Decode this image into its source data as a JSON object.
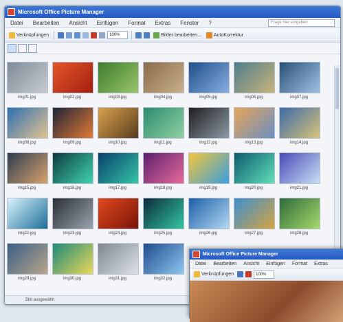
{
  "window": {
    "title": "Microsoft Office Picture Manager",
    "menu": [
      "Datei",
      "Bearbeiten",
      "Ansicht",
      "Einfügen",
      "Format",
      "Extras",
      "Fenster",
      "?"
    ],
    "help_placeholder": "Frage hier eingeben",
    "toolbar": {
      "shortcuts_label": "Verknüpfungen",
      "zoom": "100%",
      "edit_label": "Bilder bearbeiten...",
      "autocorrect_label": "AutoKorrektur"
    },
    "status_text": "Bild ausgewählt"
  },
  "thumbnails": [
    {
      "caption": "img01.jpg",
      "colors": [
        "#7f8a96",
        "#c7ccd2"
      ]
    },
    {
      "caption": "img02.jpg",
      "colors": [
        "#e3562b",
        "#a61f0f"
      ]
    },
    {
      "caption": "img03.jpg",
      "colors": [
        "#3d7d2e",
        "#9ac56a"
      ]
    },
    {
      "caption": "img04.jpg",
      "colors": [
        "#8a6a4a",
        "#c9b08a"
      ]
    },
    {
      "caption": "img05.jpg",
      "colors": [
        "#1e4f8a",
        "#87aee0"
      ]
    },
    {
      "caption": "img06.jpg",
      "colors": [
        "#4f7d8c",
        "#c7b57a"
      ]
    },
    {
      "caption": "img07.jpg",
      "colors": [
        "#2c4f78",
        "#9ec1e3"
      ]
    },
    {
      "caption": "img08.jpg",
      "colors": [
        "#2f6fb3",
        "#e2c48f"
      ]
    },
    {
      "caption": "img09.jpg",
      "colors": [
        "#1e2438",
        "#e37a35"
      ]
    },
    {
      "caption": "img10.jpg",
      "colors": [
        "#d9a24b",
        "#5a3b1e"
      ]
    },
    {
      "caption": "img11.jpg",
      "colors": [
        "#2c8c6e",
        "#8fd1a2"
      ]
    },
    {
      "caption": "img12.jpg",
      "colors": [
        "#1f1f1f",
        "#8e9aa6"
      ]
    },
    {
      "caption": "img13.jpg",
      "colors": [
        "#e6a55b",
        "#6a8fc0"
      ]
    },
    {
      "caption": "img14.jpg",
      "colors": [
        "#3c6aa8",
        "#d9c37a"
      ]
    },
    {
      "caption": "img15.jpg",
      "colors": [
        "#2e3d52",
        "#d8a26b"
      ]
    },
    {
      "caption": "img16.jpg",
      "colors": [
        "#0e3a3d",
        "#3fd5b0"
      ]
    },
    {
      "caption": "img17.jpg",
      "colors": [
        "#0a3f6b",
        "#33c6a6"
      ]
    },
    {
      "caption": "img18.jpg",
      "colors": [
        "#5b1f6e",
        "#e86a9a"
      ]
    },
    {
      "caption": "img19.jpg",
      "colors": [
        "#f2c43a",
        "#3aa0e0"
      ]
    },
    {
      "caption": "img20.jpg",
      "colors": [
        "#0e5a6e",
        "#5fe0b8"
      ]
    },
    {
      "caption": "img21.jpg",
      "colors": [
        "#4a4ab8",
        "#c7e0f5"
      ]
    },
    {
      "caption": "img22.jpg",
      "colors": [
        "#d9f2fb",
        "#1d6f9a"
      ]
    },
    {
      "caption": "img23.jpg",
      "colors": [
        "#2b2f36",
        "#9aa3ad"
      ]
    },
    {
      "caption": "img24.jpg",
      "colors": [
        "#e04a1d",
        "#7a1208"
      ]
    },
    {
      "caption": "img25.jpg",
      "colors": [
        "#0c2a3c",
        "#32c7a0"
      ]
    },
    {
      "caption": "img26.jpg",
      "colors": [
        "#1b5fa8",
        "#b3d8f2"
      ]
    },
    {
      "caption": "img27.jpg",
      "colors": [
        "#3f8fcf",
        "#d4a441"
      ]
    },
    {
      "caption": "img28.jpg",
      "colors": [
        "#2d6b3a",
        "#a6d86a"
      ]
    },
    {
      "caption": "img29.jpg",
      "colors": [
        "#3a5f86",
        "#b8a58a"
      ]
    },
    {
      "caption": "img30.jpg",
      "colors": [
        "#1f8a7a",
        "#e9d85a"
      ]
    },
    {
      "caption": "img31.jpg",
      "colors": [
        "#7e868f",
        "#dde2e7"
      ]
    },
    {
      "caption": "img32.jpg",
      "colors": [
        "#1e4b8c",
        "#8fc6f0"
      ]
    }
  ],
  "second_window": {
    "title": "Microsoft Office Picture Manager",
    "menu": [
      "Datei",
      "Bearbeiten",
      "Ansicht",
      "Einfügen",
      "Format",
      "Extras"
    ],
    "toolbar": {
      "shortcuts_label": "Verknüpfungen",
      "zoom": "100%"
    }
  }
}
